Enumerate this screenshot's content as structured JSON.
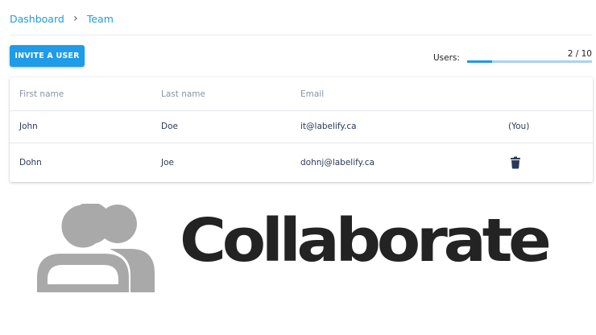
{
  "breadcrumb": {
    "items": [
      "Dashboard",
      "Team"
    ],
    "separator": "›"
  },
  "toolbar": {
    "invite_label": "INVITE A USER"
  },
  "quota": {
    "label": "Users:",
    "count_text": "2 / 10",
    "used": 2,
    "max": 10
  },
  "table": {
    "columns": [
      "First name",
      "Last name",
      "Email"
    ],
    "rows": [
      {
        "first": "John",
        "last": "Doe",
        "email": "it@labelify.ca",
        "action": "(You)"
      },
      {
        "first": "Dohn",
        "last": "Joe",
        "email": "dohnj@labelify.ca",
        "action_icon": "trash-icon"
      }
    ]
  },
  "banner": {
    "title": "Collaborate",
    "icon": "users-icon"
  },
  "colors": {
    "accent": "#1e9be9",
    "text_dark": "#2c3a58",
    "header_text": "#8a93a6",
    "icon_gray": "#a9a9a9",
    "title_dark": "#232323"
  }
}
